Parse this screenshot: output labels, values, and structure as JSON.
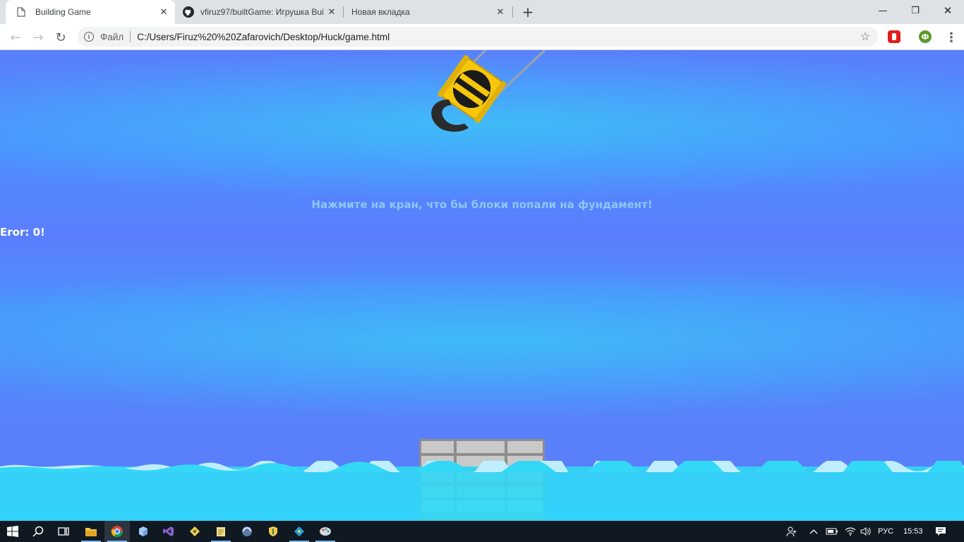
{
  "browser": {
    "tabs": [
      {
        "title": "Building Game",
        "active": true
      },
      {
        "title": "vfiruz97/builtGame: Игрушка Bui",
        "active": false
      },
      {
        "title": "Новая вкладка",
        "active": false
      }
    ],
    "new_tab_label": "+",
    "window_controls": {
      "minimize": "—",
      "restore": "❐",
      "close": "✕"
    },
    "nav": {
      "back": "←",
      "forward": "→",
      "reload": "↻"
    },
    "address": {
      "info_icon": "i",
      "scheme_label": "Файл",
      "url": "C:/Users/Firuz%20%20Zafarovich/Desktop/Huck/game.html",
      "bookmark_icon": "☆"
    },
    "extensions": {
      "adblock_color": "#e11d1d",
      "profile_letter": "Ф",
      "profile_color": "#5a9c2a"
    },
    "menu_icon": "⋮"
  },
  "game": {
    "instruction": "Нажмите на кран, что бы блоки попали на фундамент!",
    "score_text": "Eror: 0!",
    "sky_colors": [
      "#5a7ffb",
      "#3fbbf8"
    ],
    "water_color": "#2edcfb",
    "hook_colors": {
      "yellow": "#f7c70c",
      "black": "#1b1b1b",
      "hook": "#2b2b2b"
    }
  },
  "taskbar": {
    "apps": [
      {
        "icon": "windows-start-icon",
        "running": false,
        "active": false
      },
      {
        "icon": "search-icon",
        "running": false,
        "active": false
      },
      {
        "icon": "task-view-icon",
        "running": false,
        "active": false
      },
      {
        "icon": "file-explorer-icon",
        "running": true,
        "active": false
      },
      {
        "icon": "chrome-icon",
        "running": true,
        "active": true
      },
      {
        "icon": "cube-app-icon",
        "running": false,
        "active": false
      },
      {
        "icon": "visual-studio-icon",
        "running": false,
        "active": false
      },
      {
        "icon": "git-icon",
        "running": false,
        "active": false
      },
      {
        "icon": "notepad-icon",
        "running": true,
        "active": false
      },
      {
        "icon": "browser-globe-icon",
        "running": false,
        "active": false
      },
      {
        "icon": "shield-app-icon",
        "running": false,
        "active": false
      },
      {
        "icon": "git-kraken-icon",
        "running": true,
        "active": false
      },
      {
        "icon": "paint-icon",
        "running": true,
        "active": false
      }
    ],
    "tray": {
      "language": "РУС",
      "time": "15:53"
    }
  }
}
